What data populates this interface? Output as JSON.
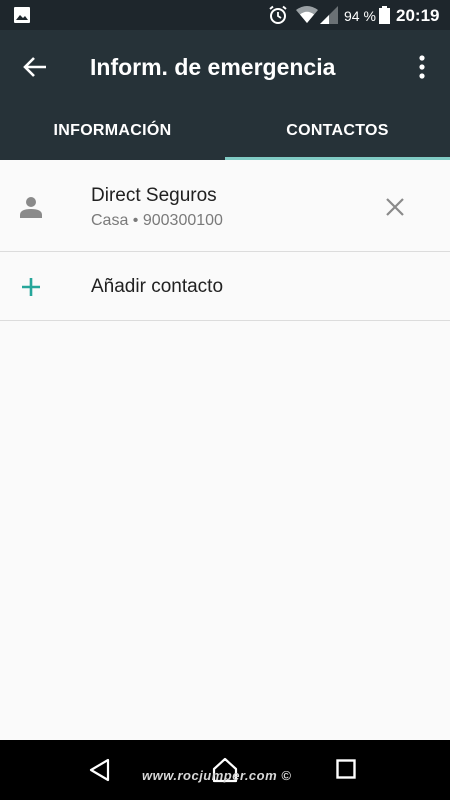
{
  "status_bar": {
    "battery_percent": "94 %",
    "time": "20:19"
  },
  "app_bar": {
    "title": "Inform. de emergencia"
  },
  "tabs": [
    {
      "label": "INFORMACIÓN",
      "selected": false
    },
    {
      "label": "CONTACTOS",
      "selected": true
    }
  ],
  "contacts": [
    {
      "name": "Direct Seguros",
      "detail": "Casa • 900300100"
    }
  ],
  "add_contact": {
    "label": "Añadir contacto"
  },
  "nav_bar": {
    "watermark": "www.rocjumper.com ©"
  },
  "colors": {
    "app_bar": "#263238",
    "status_bar": "#1e262c",
    "tab_indicator": "#80cbc4",
    "accent": "#26a69a",
    "background": "#fafafa"
  }
}
